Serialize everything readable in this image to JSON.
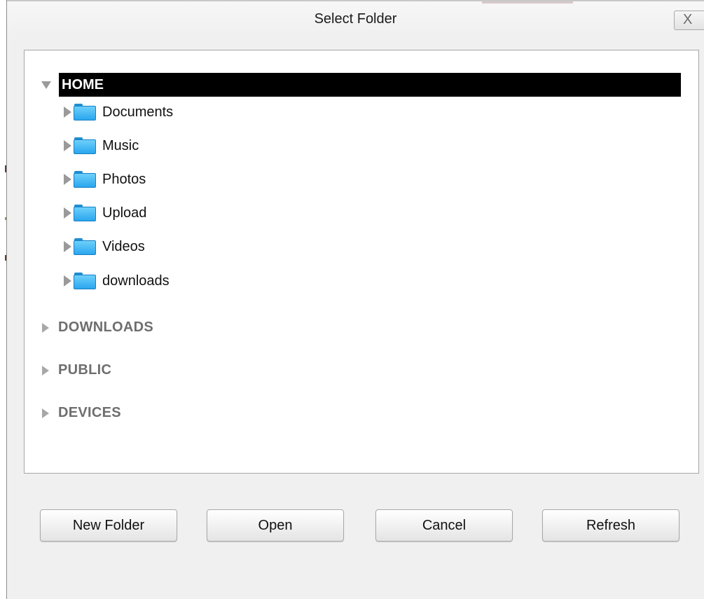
{
  "dialog": {
    "title": "Select Folder",
    "close_glyph": "X"
  },
  "tree": {
    "home": {
      "label": "HOME",
      "expanded": true,
      "selected": true,
      "children": [
        {
          "label": "Documents"
        },
        {
          "label": "Music"
        },
        {
          "label": "Photos"
        },
        {
          "label": "Upload"
        },
        {
          "label": "Videos"
        },
        {
          "label": "downloads"
        }
      ]
    },
    "sections": [
      {
        "label": "DOWNLOADS",
        "expanded": false
      },
      {
        "label": "PUBLIC",
        "expanded": false
      },
      {
        "label": "DEVICES",
        "expanded": false
      }
    ]
  },
  "buttons": {
    "new_folder": "New Folder",
    "open": "Open",
    "cancel": "Cancel",
    "refresh": "Refresh"
  },
  "icons": {
    "folder": "folder-icon",
    "expand_collapsed": "chevron-right-icon",
    "expand_open": "chevron-down-icon",
    "close": "close-icon"
  },
  "colors": {
    "selection_bg": "#000000",
    "selection_fg": "#ffffff",
    "folder_blue": "#2aa6ee",
    "dialog_bg": "#f0f0f0"
  }
}
